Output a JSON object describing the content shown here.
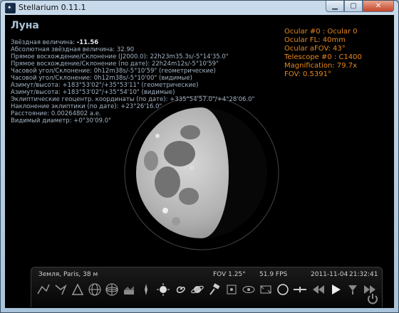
{
  "window": {
    "title": "Stellarium 0.11.1",
    "icon": "stellarium-app-icon"
  },
  "object": {
    "name": "Луна",
    "info_lines": [
      {
        "label": "Звёздная величина: ",
        "value": "-11.56",
        "highlight": true
      },
      {
        "label": "Абсолютная звёздная величина: ",
        "value": "32.90"
      },
      {
        "label": "Прямое восхождение/Склонение (J2000.0): ",
        "value": "22h23m35.3s/-5°14'35.0\""
      },
      {
        "label": "Прямое восхождение/Склонение (по дате): ",
        "value": "22h24m12s/-5°10'59\""
      },
      {
        "label": "Часовой угол/Склонение: ",
        "value": "0h12m38s/-5°10'59\" (геометрические)"
      },
      {
        "label": "Часовой угол/Склонение: ",
        "value": "0h12m38s/-5°10'00\" (видимые)"
      },
      {
        "label": "Азимут/высота: ",
        "value": "+183°53'02\"/+35°53'11\" (геометрические)"
      },
      {
        "label": "Азимут/высота: ",
        "value": "+183°53'02\"/+35°54'10\" (видимые)"
      },
      {
        "label": "Эклиптические геоцентр. координаты (по дате): ",
        "value": "+335°54'57.0\"/+4°28'06.0\""
      },
      {
        "label": "Наклонение эклиптики (по дате): ",
        "value": "+23°26'16.0\""
      },
      {
        "label": "Расстояние: ",
        "value": "0.00264802 а.е."
      },
      {
        "label": "Видимый диаметр: ",
        "value": "+0°30'09.0\""
      }
    ]
  },
  "ocular": {
    "lines": [
      "Ocular #0 : Ocular 0",
      "Ocular FL: 40mm",
      "Ocular aFOV: 43°",
      "Telescope #0 : C1400",
      "Magnification: 79.7x",
      "FOV: 0.5391°"
    ],
    "color": "#e5871f"
  },
  "statusbar": {
    "location": "Земля, Paris, 38 м",
    "fov": "FOV 1.25°",
    "fps": "51.9 FPS",
    "date": "2011-11-04",
    "time": "21:32:41"
  },
  "toolbar": {
    "buttons": [
      "constellation-lines-icon",
      "constellation-labels-icon",
      "constellation-art-icon",
      "equatorial-grid-icon",
      "azimuthal-grid-icon",
      "ground-icon",
      "cardinal-points-icon",
      "atmosphere-icon",
      "nebula-icon",
      "planet-labels-icon",
      "mount-toggle-icon",
      "center-object-icon",
      "night-mode-icon",
      "fullscreen-icon",
      "ocular-icon",
      "crosshair-icon",
      "rewind-icon",
      "play-icon",
      "now-icon",
      "fast-forward-icon",
      "quit-icon"
    ]
  },
  "colors": {
    "info_text": "#a3b4c4",
    "object_name": "#a9c1d6",
    "accent": "#e5871f"
  }
}
